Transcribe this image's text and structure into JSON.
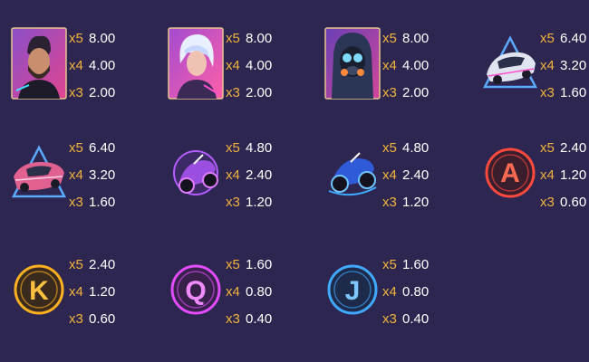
{
  "colors": {
    "background": "#2d2650",
    "multiplier": "#f2b33d",
    "value": "#ffffff"
  },
  "symbols": [
    {
      "id": "cyber-man",
      "icon": "cyberpunk-man-portrait",
      "pays": [
        {
          "mult": "x5",
          "val": "8.00"
        },
        {
          "mult": "x4",
          "val": "4.00"
        },
        {
          "mult": "x3",
          "val": "2.00"
        }
      ]
    },
    {
      "id": "cyber-woman",
      "icon": "cyberpunk-woman-portrait",
      "pays": [
        {
          "mult": "x5",
          "val": "8.00"
        },
        {
          "mult": "x4",
          "val": "4.00"
        },
        {
          "mult": "x3",
          "val": "2.00"
        }
      ]
    },
    {
      "id": "masked-hacker",
      "icon": "gas-mask-hacker-portrait",
      "pays": [
        {
          "mult": "x5",
          "val": "8.00"
        },
        {
          "mult": "x4",
          "val": "4.00"
        },
        {
          "mult": "x3",
          "val": "2.00"
        }
      ]
    },
    {
      "id": "white-car",
      "icon": "white-sports-car",
      "pays": [
        {
          "mult": "x5",
          "val": "6.40"
        },
        {
          "mult": "x4",
          "val": "3.20"
        },
        {
          "mult": "x3",
          "val": "1.60"
        }
      ]
    },
    {
      "id": "pink-car",
      "icon": "pink-sports-car",
      "pays": [
        {
          "mult": "x5",
          "val": "6.40"
        },
        {
          "mult": "x4",
          "val": "3.20"
        },
        {
          "mult": "x3",
          "val": "1.60"
        }
      ]
    },
    {
      "id": "purple-bike",
      "icon": "purple-motorcycle",
      "pays": [
        {
          "mult": "x5",
          "val": "4.80"
        },
        {
          "mult": "x4",
          "val": "2.40"
        },
        {
          "mult": "x3",
          "val": "1.20"
        }
      ]
    },
    {
      "id": "blue-bike",
      "icon": "blue-motorcycle",
      "pays": [
        {
          "mult": "x5",
          "val": "4.80"
        },
        {
          "mult": "x4",
          "val": "2.40"
        },
        {
          "mult": "x3",
          "val": "1.20"
        }
      ]
    },
    {
      "id": "letter-a",
      "icon": "neon-letter-a",
      "letter": "A",
      "color": "#ff4a3d",
      "pays": [
        {
          "mult": "x5",
          "val": "2.40"
        },
        {
          "mult": "x4",
          "val": "1.20"
        },
        {
          "mult": "x3",
          "val": "0.60"
        }
      ]
    },
    {
      "id": "letter-k",
      "icon": "neon-letter-k",
      "letter": "K",
      "color": "#ffb020",
      "pays": [
        {
          "mult": "x5",
          "val": "2.40"
        },
        {
          "mult": "x4",
          "val": "1.20"
        },
        {
          "mult": "x3",
          "val": "0.60"
        }
      ]
    },
    {
      "id": "letter-q",
      "icon": "neon-letter-q",
      "letter": "Q",
      "color": "#e04cff",
      "pays": [
        {
          "mult": "x5",
          "val": "1.60"
        },
        {
          "mult": "x4",
          "val": "0.80"
        },
        {
          "mult": "x3",
          "val": "0.40"
        }
      ]
    },
    {
      "id": "letter-j",
      "icon": "neon-letter-j",
      "letter": "J",
      "color": "#3fa8ff",
      "pays": [
        {
          "mult": "x5",
          "val": "1.60"
        },
        {
          "mult": "x4",
          "val": "0.80"
        },
        {
          "mult": "x3",
          "val": "0.40"
        }
      ]
    }
  ]
}
